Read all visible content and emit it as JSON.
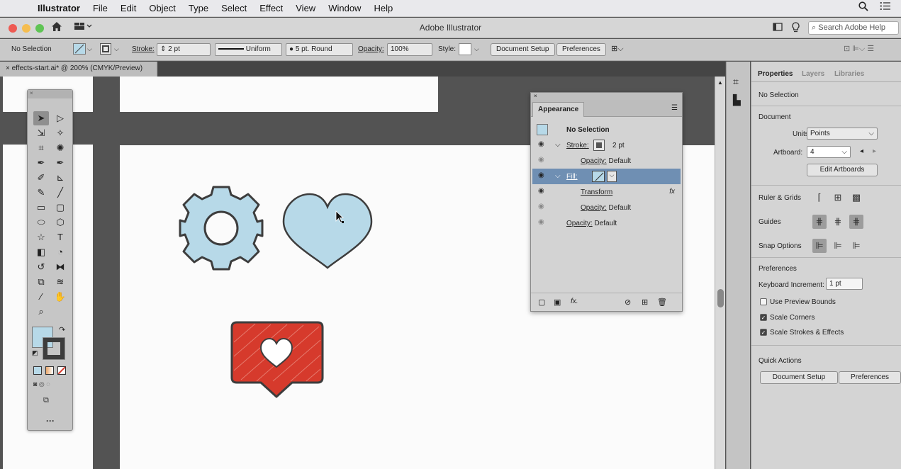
{
  "menubar": {
    "items": [
      "Illustrator",
      "File",
      "Edit",
      "Object",
      "Type",
      "Select",
      "Effect",
      "View",
      "Window",
      "Help"
    ]
  },
  "titlebar": {
    "title": "Adobe Illustrator",
    "search_placeholder": "Search Adobe Help"
  },
  "controlbar": {
    "selection": "No Selection",
    "stroke_label": "Stroke:",
    "stroke_value": "2 pt",
    "profile": "Uniform",
    "brush": "5 pt. Round",
    "opacity_label": "Opacity:",
    "opacity_value": "100%",
    "style_label": "Style:",
    "document_setup": "Document Setup",
    "preferences": "Preferences"
  },
  "doctab": {
    "title": "effects-start.ai* @ 200% (CMYK/Preview)"
  },
  "appearance": {
    "tab": "Appearance",
    "rows": [
      {
        "label": "No Selection"
      },
      {
        "label": "Stroke:",
        "value": "2 pt"
      },
      {
        "label": "Opacity:",
        "value": "Default"
      },
      {
        "label": "Fill:"
      },
      {
        "label": "Transform",
        "fx": "fx"
      },
      {
        "label": "Opacity:",
        "value": "Default"
      },
      {
        "label": "Opacity:",
        "value": "Default"
      }
    ],
    "fx_label": "fx."
  },
  "properties": {
    "tabs": [
      "Properties",
      "Layers",
      "Libraries"
    ],
    "no_selection": "No Selection",
    "document_title": "Document",
    "units_label": "Units:",
    "units_value": "Points",
    "artboard_label": "Artboard:",
    "artboard_value": "4",
    "edit_artboards": "Edit Artboards",
    "ruler_grids": "Ruler & Grids",
    "guides": "Guides",
    "snap_options": "Snap Options",
    "preferences_title": "Preferences",
    "keyboard_increment_label": "Keyboard Increment:",
    "keyboard_increment_value": "1 pt",
    "use_preview_bounds": "Use Preview Bounds",
    "scale_corners": "Scale Corners",
    "scale_strokes": "Scale Strokes & Effects",
    "quick_actions": "Quick Actions",
    "document_setup": "Document Setup",
    "preferences": "Preferences"
  },
  "colors": {
    "fill": "#b7d9e8",
    "stroke_dark": "#3d3d3d",
    "red": "#d63a2c",
    "selection_blue": "#6f8fb3"
  }
}
